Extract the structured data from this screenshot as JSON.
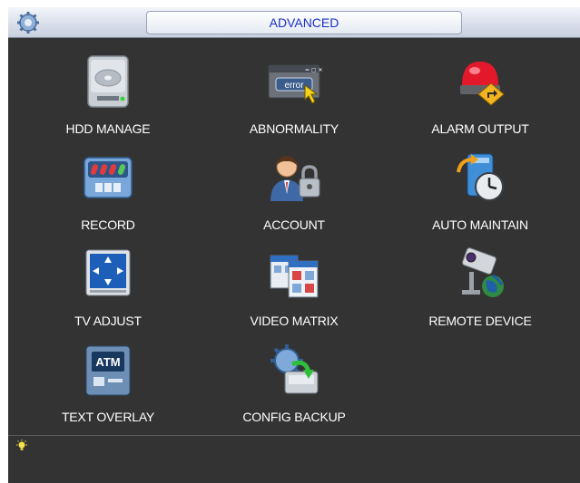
{
  "title": "ADVANCED",
  "menu": [
    {
      "label": "HDD MANAGE",
      "icon": "hdd-icon"
    },
    {
      "label": "ABNORMALITY",
      "icon": "error-window-icon"
    },
    {
      "label": "ALARM OUTPUT",
      "icon": "alarm-light-icon"
    },
    {
      "label": "RECORD",
      "icon": "record-icon"
    },
    {
      "label": "ACCOUNT",
      "icon": "account-lock-icon"
    },
    {
      "label": "AUTO MAINTAIN",
      "icon": "clock-maintain-icon"
    },
    {
      "label": "TV ADJUST",
      "icon": "tv-adjust-icon"
    },
    {
      "label": "VIDEO MATRIX",
      "icon": "video-matrix-icon"
    },
    {
      "label": "REMOTE DEVICE",
      "icon": "remote-camera-icon"
    },
    {
      "label": "TEXT OVERLAY",
      "icon": "atm-icon"
    },
    {
      "label": "CONFIG BACKUP",
      "icon": "config-backup-icon"
    }
  ],
  "error_badge": "error",
  "atm_badge": "ATM",
  "colors": {
    "background": "#333333",
    "title_text": "#1c30c6",
    "label_text": "#ffffff"
  }
}
